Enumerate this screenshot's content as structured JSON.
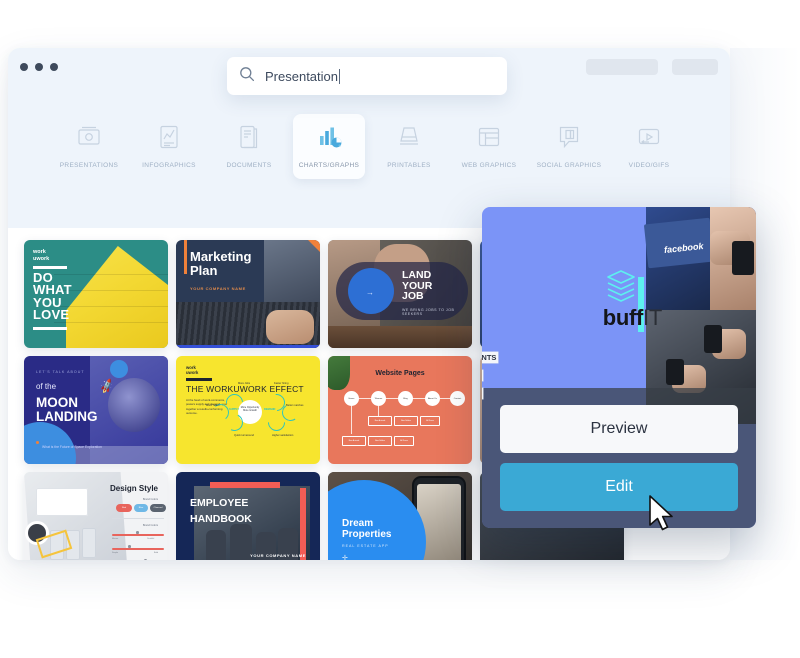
{
  "window": {
    "dots": [
      "dot-1",
      "dot-2",
      "dot-3"
    ],
    "pill_left": "",
    "pill_right": ""
  },
  "search": {
    "value": "Presentation",
    "icon": "search-icon"
  },
  "categories": [
    {
      "label": "PRESENTATIONS",
      "icon": "presentation-icon",
      "active": false
    },
    {
      "label": "INFOGRAPHICS",
      "icon": "infographic-chart-icon",
      "active": false
    },
    {
      "label": "DOCUMENTS",
      "icon": "document-icon",
      "active": false
    },
    {
      "label": "CHARTS/GRAPHS",
      "icon": "bar-chart-pie-icon",
      "active": true
    },
    {
      "label": "PRINTABLES",
      "icon": "printables-stack-icon",
      "active": false
    },
    {
      "label": "WEB GRAPHICS",
      "icon": "web-browser-icon",
      "active": false
    },
    {
      "label": "SOCIAL GRAPHICS",
      "icon": "speech-bubble-icon",
      "active": false
    },
    {
      "label": "VIDEO/GIFS",
      "icon": "video-play-icon",
      "active": false
    }
  ],
  "templates": [
    {
      "id": "t1",
      "brand": "work\nuwork",
      "title": "DO\nWHAT\nYOU\nLOVE"
    },
    {
      "id": "t2",
      "title": "Marketing\nPlan",
      "subtitle": "YOUR COMPANY NAME"
    },
    {
      "id": "t3",
      "title": "LAND\nYOUR\nJOB",
      "subtitle": "WE BRING JOBS TO JOB SEEKERS"
    },
    {
      "id": "t4",
      "kicker": "LET'S TALK ABOUT",
      "of": "of the",
      "title": "MOON\nLANDING",
      "note": "What is the Future of Space Exploration",
      "side": "buffIT"
    },
    {
      "id": "t5",
      "brand": "work\nuwork",
      "title": "THE WORKUWORK EFFECT",
      "body": "At the heart of work-commerce, powers supply and demand, your together a results-conforming outcome.",
      "hub": "More Opportunity, More Growth",
      "captions": [
        "SUPPLY",
        "DEMAND",
        "More Jobs",
        "Faster hiring",
        "More Talent",
        "Better matches",
        "Quick turnaround",
        "Higher satisfaction & retention"
      ]
    },
    {
      "id": "t6",
      "title": "Website Pages",
      "nodes": [
        "Home",
        "Women",
        "Blog",
        "About Us",
        "Contact"
      ],
      "boxes": [
        "New Arrivals",
        "New Sellers",
        "All Dress"
      ]
    },
    {
      "id": "t7",
      "title": "Design Style",
      "section1": "Brand Colors",
      "section2": "Brand Colors",
      "pills": [
        "Red",
        "Blue",
        "Charcoal"
      ],
      "sliders": [
        "Mature",
        "Youthful",
        "Simple",
        "Bold",
        "Geometric",
        "Organic"
      ]
    },
    {
      "id": "t8",
      "title": "EMPLOYEE\nHANDBOOK",
      "subtitle": "YOUR COMPANY NAME"
    },
    {
      "id": "t9",
      "title": "Dream\nProperties",
      "subtitle": "REAL ESTATE APP"
    },
    {
      "id": "t10",
      "title": ""
    },
    {
      "id": "t11",
      "title": ""
    },
    {
      "id": "t12",
      "title": ""
    }
  ],
  "overlay": {
    "logo_name": "buffIT",
    "logo_bold": "buff",
    "logo_light": "IT",
    "logo_icon": "stacked-layers-icon",
    "logo_accent_color": "#5df0ef",
    "fragments": [
      "UNTS",
      "E",
      "E"
    ],
    "preview_label": "Preview",
    "edit_label": "Edit",
    "edit_color": "#3aa9d5",
    "preview_color": "#f7f8fa",
    "cursor": "arrow-cursor"
  }
}
